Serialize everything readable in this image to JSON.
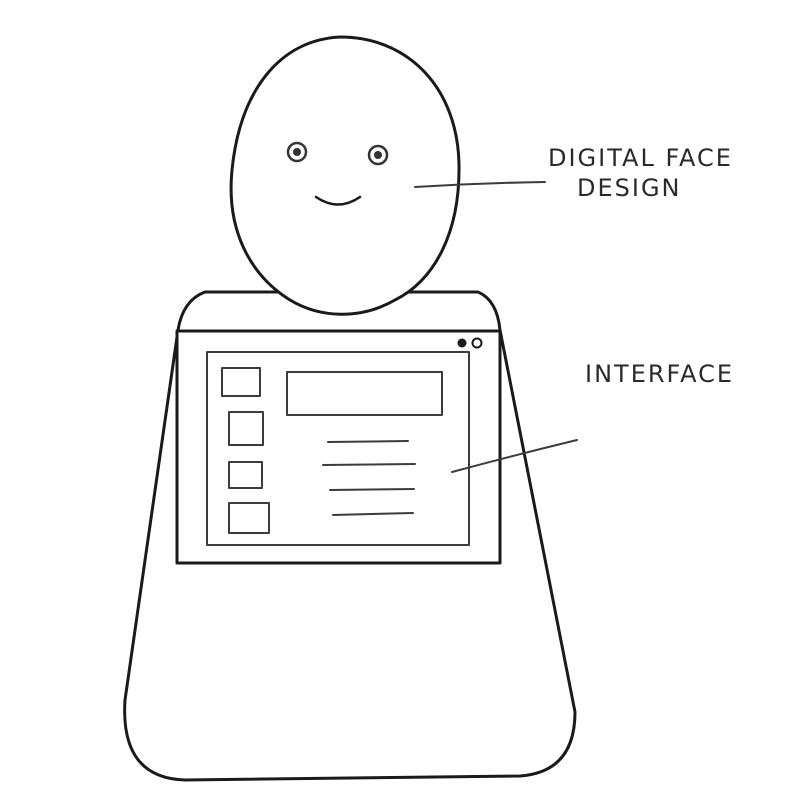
{
  "labels": {
    "face_line1": "DIGITAL FACE",
    "face_line2": "DESIGN",
    "interface": "INTERFACE"
  },
  "colors": {
    "ink": "#1a1a1a",
    "paper": "#ffffff"
  },
  "screen": {
    "sidebar_checkboxes": 4,
    "content_lines": 4,
    "window_dots": [
      "filled",
      "hollow"
    ]
  }
}
